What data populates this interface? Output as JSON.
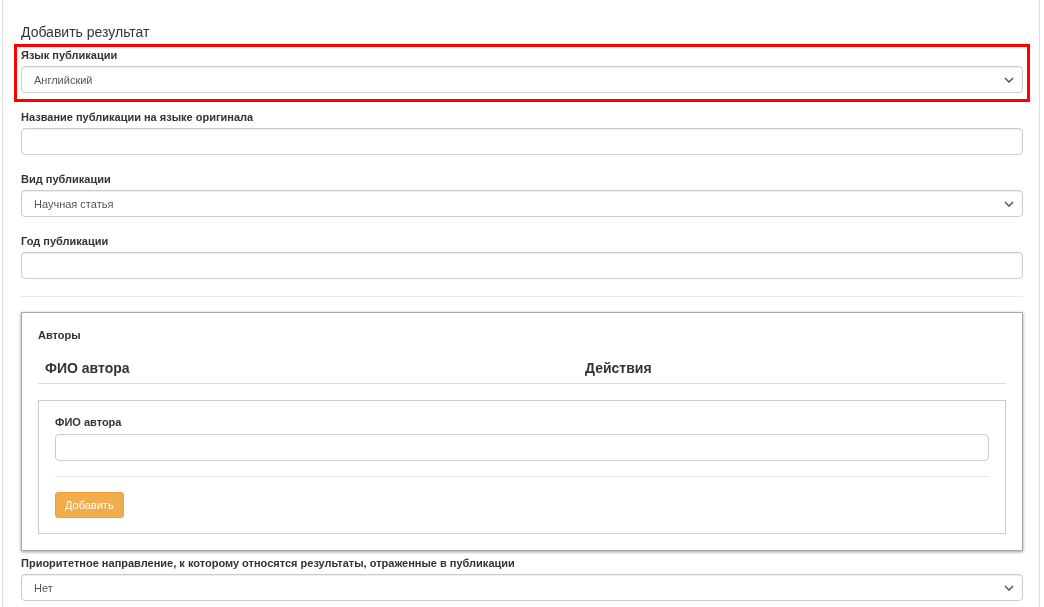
{
  "title": "Добавить результат",
  "fields": [
    {
      "kind": "select",
      "label": "Язык публикации",
      "value": "Английский",
      "highlighted": true
    },
    {
      "kind": "text",
      "label": "Название публикации на языке оригинала",
      "highlighted": false
    },
    {
      "kind": "select",
      "label": "Вид публикации",
      "value": "Научная статья",
      "highlighted": false
    },
    {
      "kind": "text",
      "label": "Год публикации",
      "highlighted": false
    }
  ],
  "authors": {
    "title": "Авторы",
    "columns": [
      "ФИО автора",
      "Действия"
    ],
    "form": {
      "label": "ФИО автора",
      "button": "Добавить"
    }
  },
  "after_fields": [
    {
      "kind": "select",
      "label": "Приоритетное направление, к которому относятся результаты, отраженные в публикации",
      "value": "Нет",
      "highlighted": false
    }
  ]
}
